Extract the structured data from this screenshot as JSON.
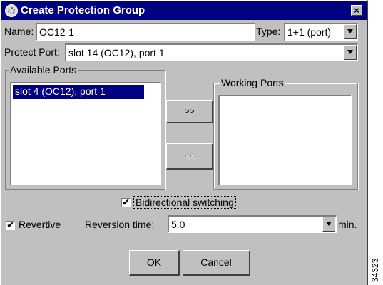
{
  "window": {
    "title": "Create Protection Group",
    "close_label": "×"
  },
  "name_field": {
    "label": "Name:",
    "value": "OC12-1"
  },
  "type_field": {
    "label": "Type:",
    "value": "1+1 (port)"
  },
  "protect_port": {
    "label": "Protect Port:",
    "value": "slot 14 (OC12), port 1"
  },
  "available_ports": {
    "title": "Available Ports",
    "items": [
      "slot  4 (OC12), port 1"
    ]
  },
  "working_ports": {
    "title": "Working Ports",
    "items": []
  },
  "move_buttons": {
    "add_label": ">>",
    "remove_label": "<<"
  },
  "bidirectional": {
    "label": "Bidirectional switching",
    "checked": true,
    "mark": "✔"
  },
  "revertive": {
    "label": "Revertive",
    "checked": true,
    "mark": "✔"
  },
  "reversion_time": {
    "label": "Reversion time:",
    "value": "5.0",
    "unit": "min."
  },
  "dialog_buttons": {
    "ok_label": "OK",
    "cancel_label": "Cancel"
  },
  "figure_id": "34323"
}
